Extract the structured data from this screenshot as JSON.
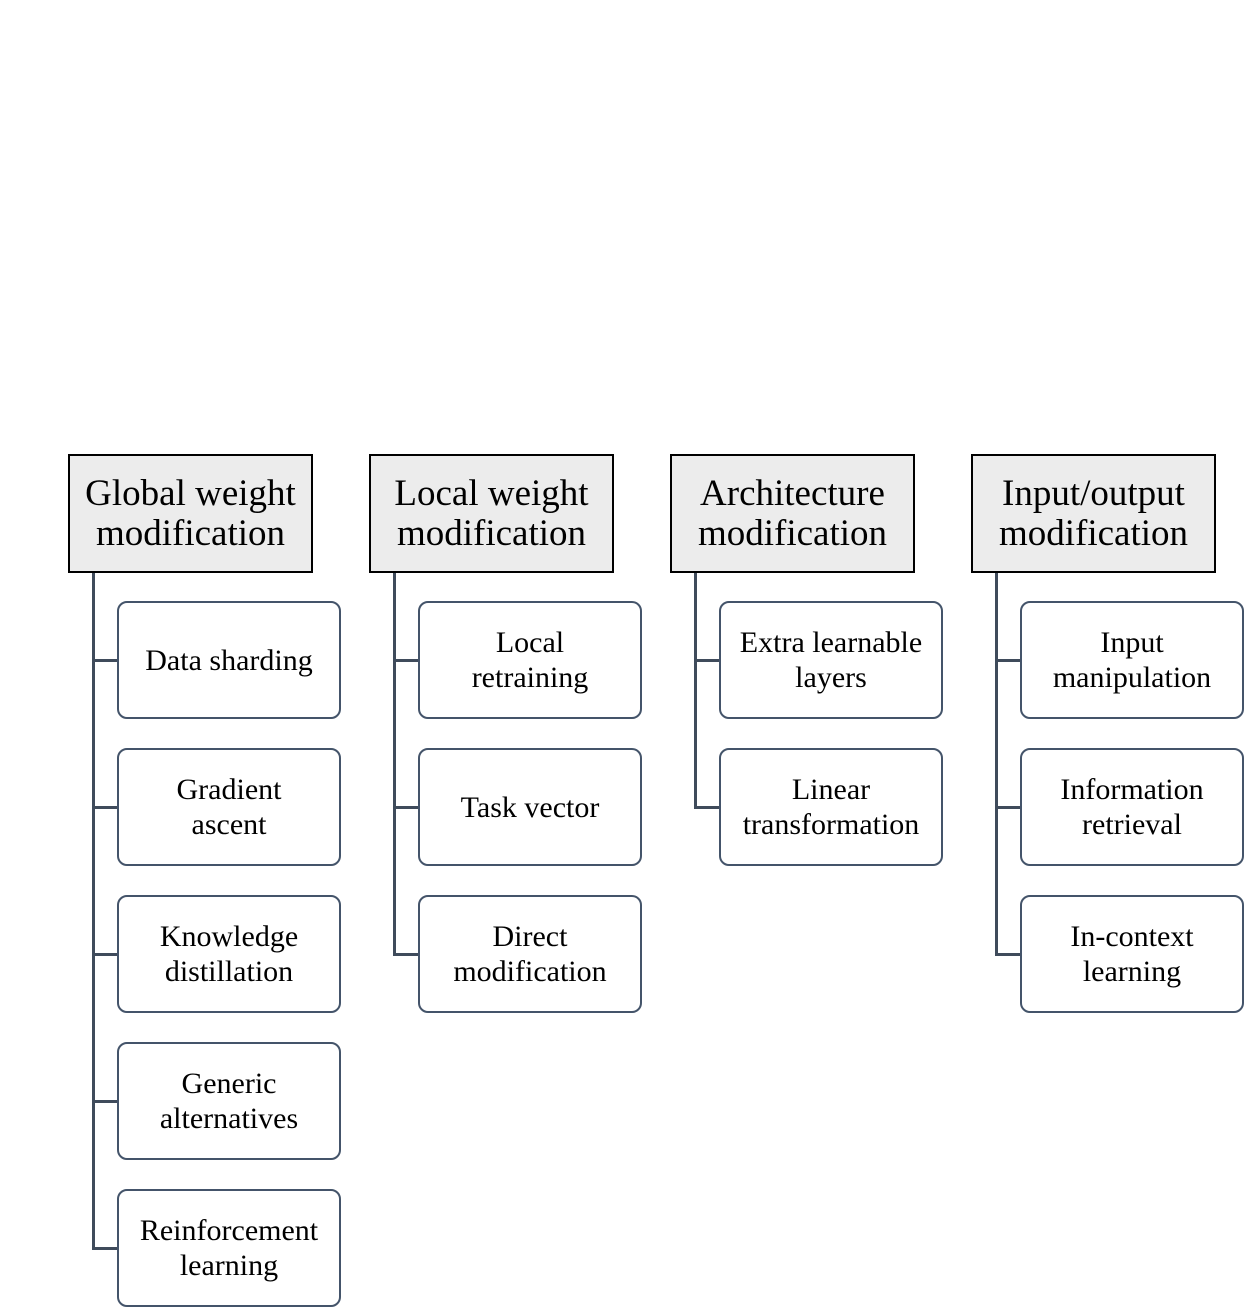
{
  "diagram": {
    "columns": [
      {
        "title_line1": "Global weight",
        "title_line2": "modification",
        "children": [
          {
            "line1": "Data sharding",
            "line2": ""
          },
          {
            "line1": "Gradient",
            "line2": "ascent"
          },
          {
            "line1": "Knowledge",
            "line2": "distillation"
          },
          {
            "line1": "Generic",
            "line2": "alternatives"
          },
          {
            "line1": "Reinforcement",
            "line2": "learning"
          }
        ]
      },
      {
        "title_line1": "Local weight",
        "title_line2": "modification",
        "children": [
          {
            "line1": "Local",
            "line2": "retraining"
          },
          {
            "line1": "Task vector",
            "line2": ""
          },
          {
            "line1": "Direct",
            "line2": "modification"
          }
        ]
      },
      {
        "title_line1": "Architecture",
        "title_line2": "modification",
        "children": [
          {
            "line1": "Extra learnable",
            "line2": "layers"
          },
          {
            "line1": "Linear",
            "line2": "transformation"
          }
        ]
      },
      {
        "title_line1": "Input/output",
        "title_line2": "modification",
        "children": [
          {
            "line1": "Input",
            "line2": "manipulation"
          },
          {
            "line1": "Information",
            "line2": "retrieval"
          },
          {
            "line1": "In-context",
            "line2": "learning"
          }
        ]
      }
    ]
  }
}
